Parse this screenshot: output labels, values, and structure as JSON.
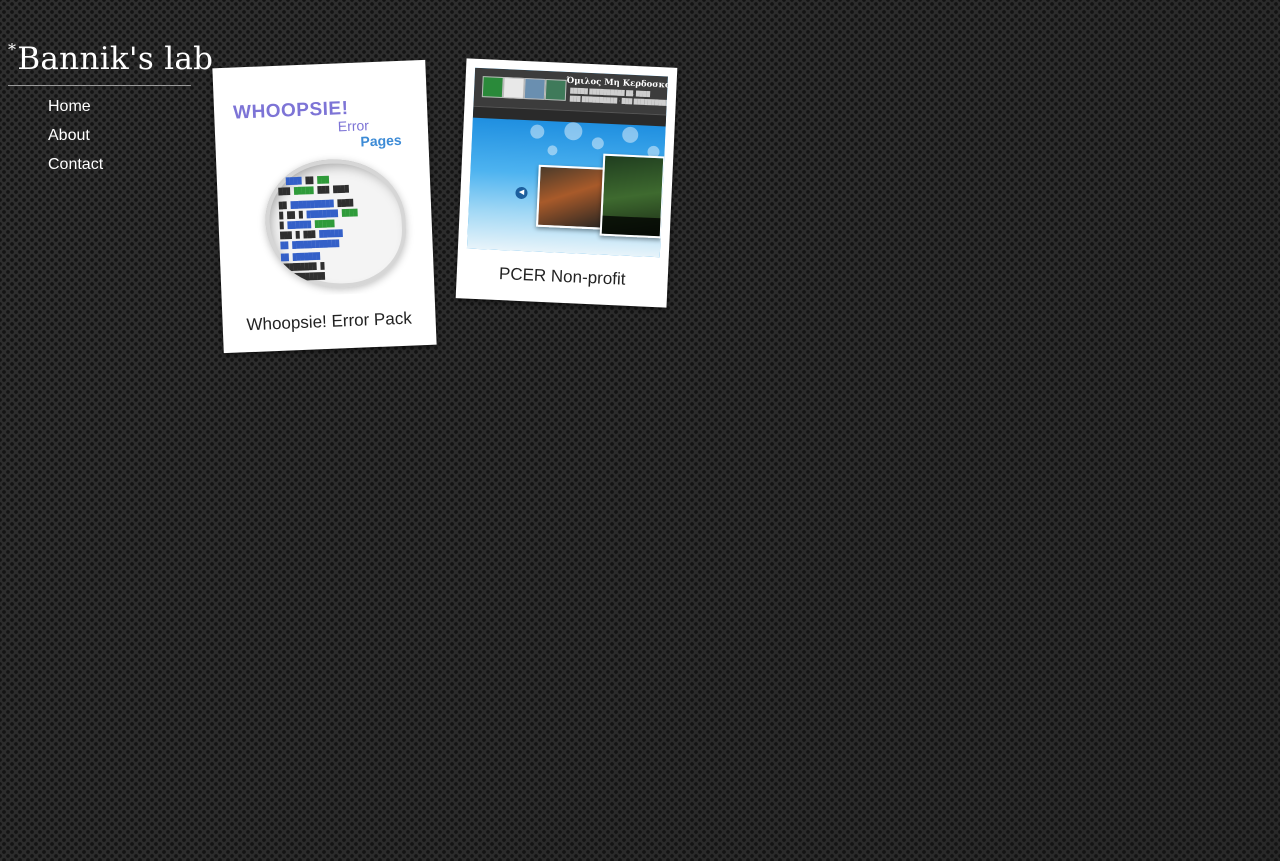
{
  "site": {
    "asterisk": "*",
    "title": "Bannik's lab"
  },
  "nav": {
    "items": [
      {
        "label": "Home"
      },
      {
        "label": "About"
      },
      {
        "label": "Contact"
      }
    ]
  },
  "portfolio": {
    "items": [
      {
        "caption": "Whoopsie! Error Pack",
        "thumbnail_text": {
          "title": "WHOOPSIE!",
          "line2": "Error",
          "line3": "Pages"
        }
      },
      {
        "caption": "PCER Non-profit",
        "thumbnail_text": {
          "org_name": "Όμιλος Μη Κερδοσκοπικ"
        }
      }
    ]
  },
  "colors": {
    "background": "#2b2b2b",
    "text": "#ffffff",
    "card": "#ffffff",
    "caption": "#222222"
  }
}
